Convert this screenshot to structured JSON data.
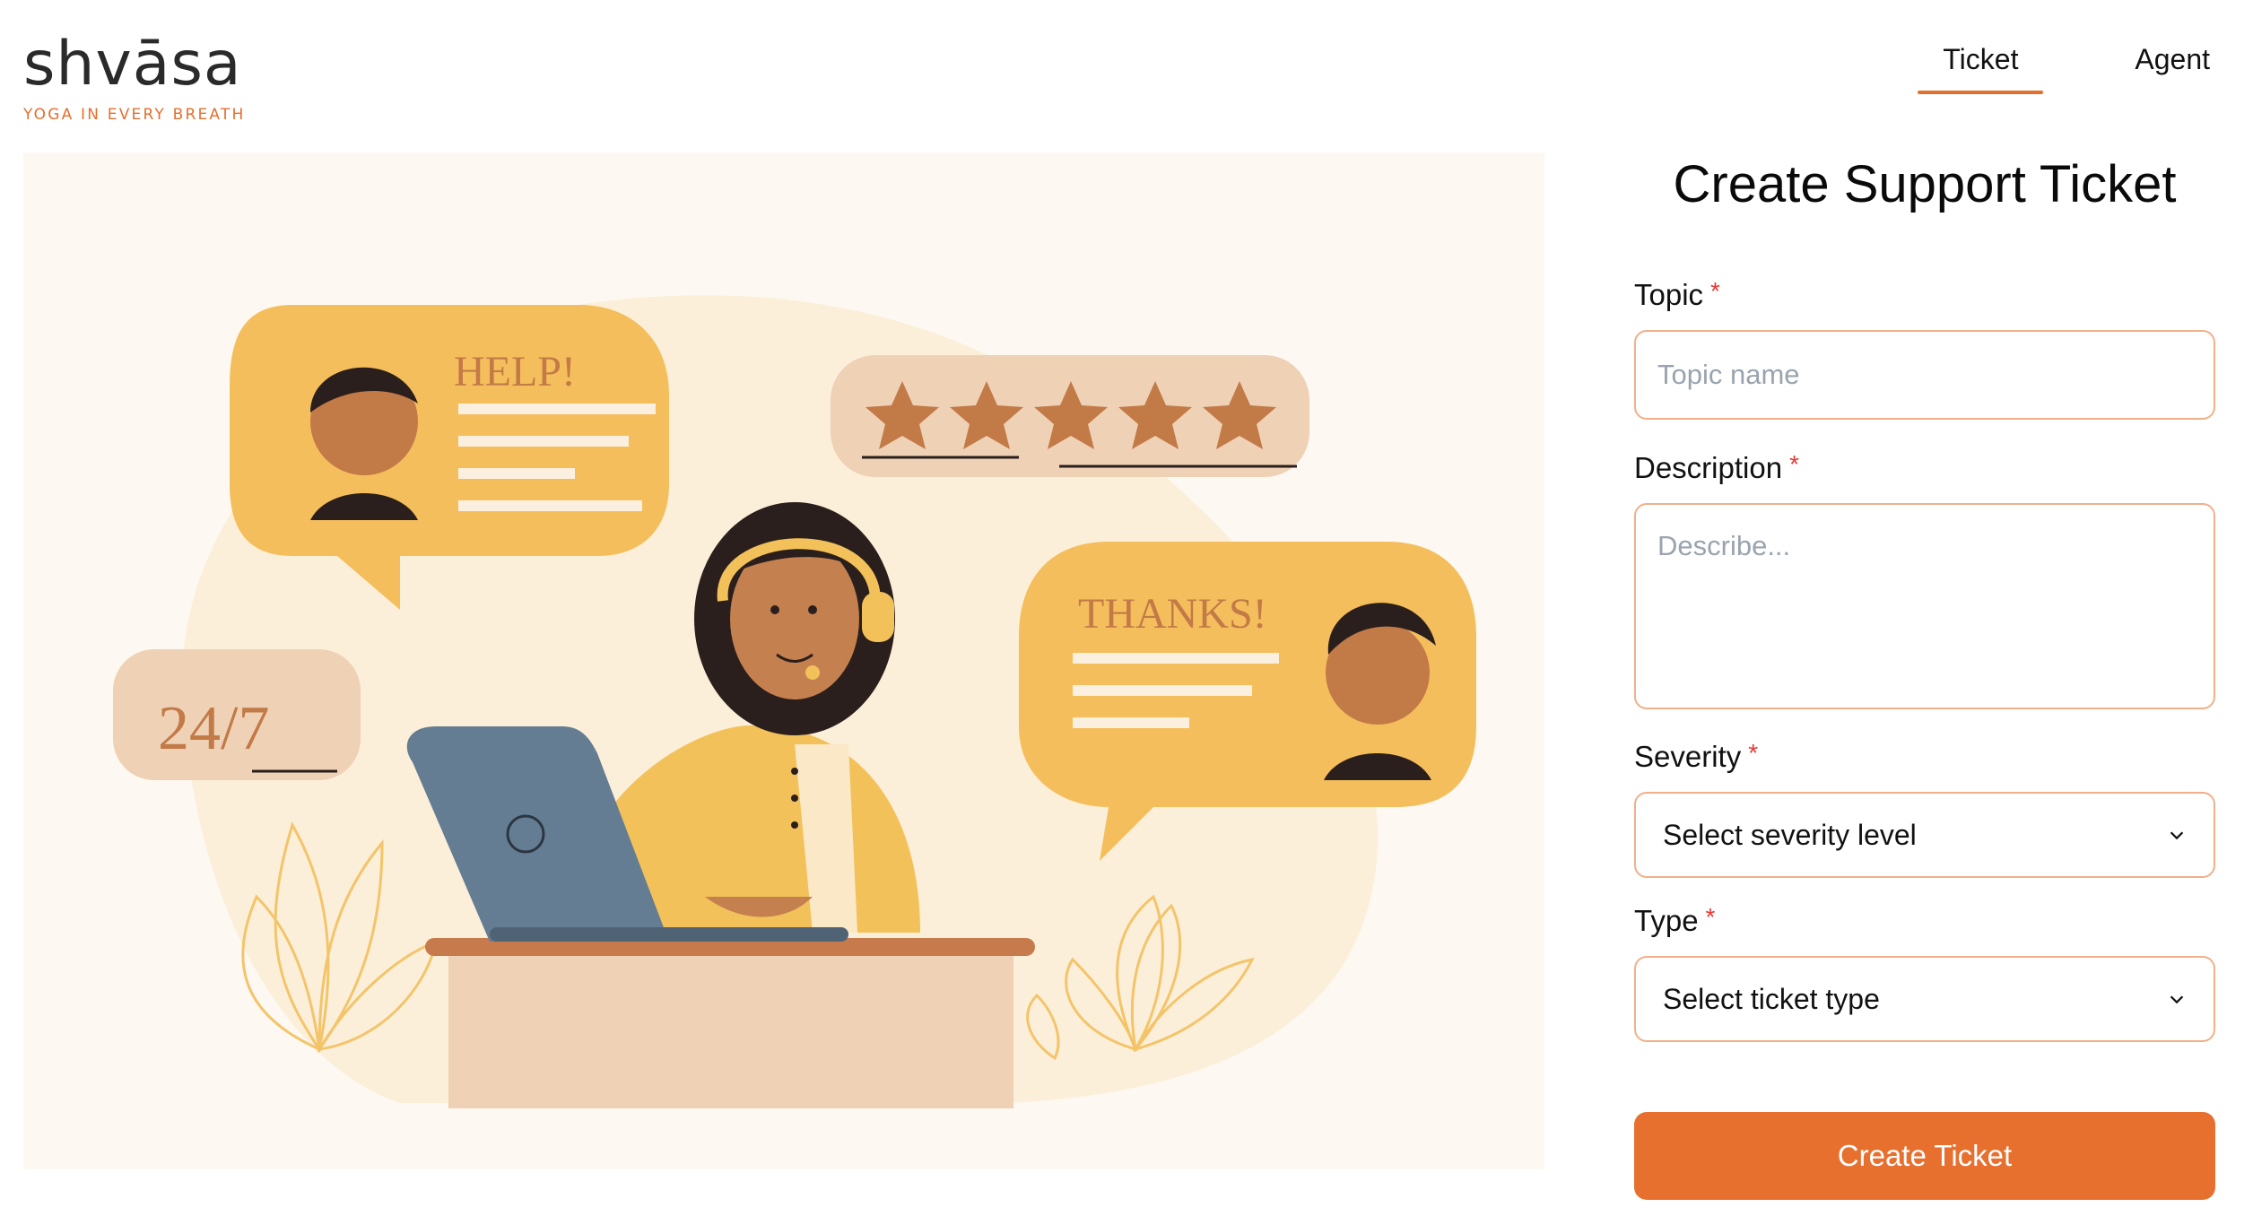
{
  "brand": {
    "name": "shvāsa",
    "tagline": "YOGA IN EVERY BREATH",
    "accent": "#e7702f"
  },
  "nav": {
    "items": [
      {
        "label": "Ticket",
        "active": true
      },
      {
        "label": "Agent",
        "active": false
      }
    ]
  },
  "illustration": {
    "bubble_help": "HELP!",
    "bubble_thanks": "THANKS!",
    "bubble_247": "24/7",
    "stars": 5
  },
  "form": {
    "title": "Create Support Ticket",
    "required_marker": "*",
    "topic": {
      "label": "Topic",
      "placeholder": "Topic name",
      "value": ""
    },
    "description": {
      "label": "Description",
      "placeholder": "Describe...",
      "value": ""
    },
    "severity": {
      "label": "Severity",
      "selected": "Select severity level"
    },
    "type": {
      "label": "Type",
      "selected": "Select ticket type"
    },
    "submit_label": "Create Ticket"
  }
}
